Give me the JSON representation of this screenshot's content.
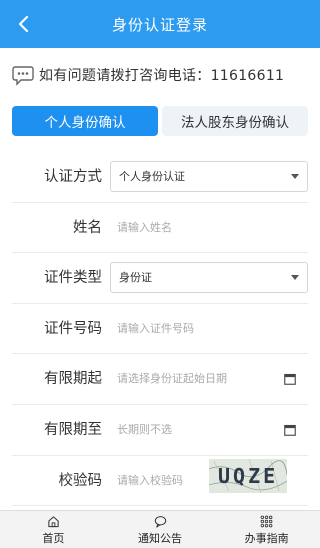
{
  "header": {
    "title": "身份认证登录"
  },
  "hotline": {
    "text": "如有问题请拨打咨询电话：11616611"
  },
  "tabs": [
    {
      "label": "个人身份确认",
      "active": true
    },
    {
      "label": "法人股东身份确认",
      "active": false
    }
  ],
  "form": {
    "auth_method": {
      "label": "认证方式",
      "value": "个人身份认证"
    },
    "name": {
      "label": "姓名",
      "placeholder": "请输入姓名"
    },
    "id_type": {
      "label": "证件类型",
      "value": "身份证"
    },
    "id_number": {
      "label": "证件号码",
      "placeholder": "请输入证件号码"
    },
    "valid_from": {
      "label": "有限期起",
      "placeholder": "请选择身份证起始日期"
    },
    "valid_to": {
      "label": "有限期至",
      "placeholder": "长期则不选"
    },
    "captcha": {
      "label": "校验码",
      "placeholder": "请输入校验码",
      "code": "UQZE"
    }
  },
  "bottom_nav": [
    {
      "label": "首页",
      "icon": "home-icon"
    },
    {
      "label": "通知公告",
      "icon": "message-icon"
    },
    {
      "label": "办事指南",
      "icon": "grid-icon"
    }
  ],
  "colors": {
    "primary": "#2d9bf0",
    "tab_active": "#1e90ef",
    "tab_inactive": "#eef3f8"
  }
}
